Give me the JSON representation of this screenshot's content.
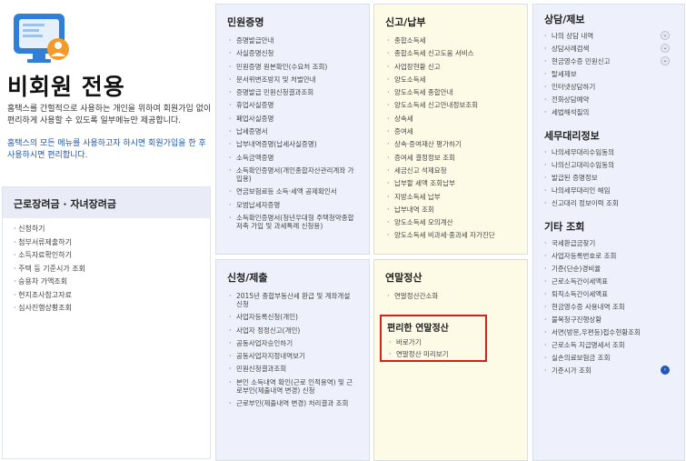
{
  "intro": {
    "title": "비회원 전용",
    "description": "홈택스를 간헐적으로 사용하는 개인을 위하여 회원가입 없이 편리하게 사용할 수 있도록 일부메뉴만 제공합니다.",
    "note": "홈택스의 모든 메뉴를 사용하고자 하시면 회원가입을 한 후 사용하시면 편리합니다."
  },
  "left_panel": {
    "title": "근로장려금 · 자녀장려금",
    "items": [
      "신청하기",
      "첨부서류제출하기",
      "소득자료확인하기",
      "주택 등 기준시가 조회",
      "승용차 가액조회",
      "현지조사참고자료",
      "심사진행상황조회"
    ]
  },
  "col_civil": {
    "title": "민원증명",
    "items": [
      "증명발급안내",
      "사실증명신청",
      "민원증명 원본확인(수요처 조회)",
      "문서위변조방지 및 처벌안내",
      "증명발급 민원신청결과조회",
      "휴업사실증명",
      "폐업사실증명",
      "납세증명서",
      "납부내역증명(납세사실증명)",
      "소득금액증명",
      "소득확인증명서(개인종합자산관리계좌 가입용)",
      "연금보험료등 소득·세액 공제확인서",
      "모범납세자증명",
      "소득확인증명서(청년우대형 주택청약종합저축 가입 및 과세특례 신청용)"
    ]
  },
  "col_report": {
    "title": "신고/납부",
    "items": [
      "종합소득세",
      "종합소득세 신고도움 서비스",
      "사업장현황 신고",
      "양도소득세",
      "양도소득세 종합안내",
      "양도소득세 신고안내정보조회",
      "상속세",
      "증여세",
      "상속·증여재산 평가하기",
      "증여세 결정정보 조회",
      "세금신고 석제요청",
      "납부할 세액 조회납부",
      "지방소득세 납부",
      "납부내역 조회",
      "양도소득세 모의계산",
      "양도소득세 비과세·중과세 자가진단"
    ]
  },
  "col_apply": {
    "title": "신청/제출",
    "items": [
      "2015년 종합부동산세 환급 및 계좌개설 신청",
      "사업자등록신청(개인)",
      "사업자 정정신고(개인)",
      "공동사업자승인하기",
      "공동사업자지정내역보기",
      "민원신청결과조회",
      "본인 소득내역 확인(근로 인적용역) 및 근로부인(제출내역 변경) 신청",
      "근로부인(제출내역 변경) 처리결과 조회"
    ]
  },
  "col_yearend": {
    "title": "연말정산",
    "items": [
      "연말정산간소화"
    ],
    "convenient": {
      "title": "편리한 연말정산",
      "items": [
        "바로가기",
        "연말정산 미리보기"
      ]
    }
  },
  "col_right": {
    "consult": {
      "title": "상담/제보",
      "items": [
        {
          "label": "나의 상담 내역",
          "toggle": "⌄"
        },
        {
          "label": "상담사례검색",
          "toggle": "⌄"
        },
        {
          "label": "현금영수증 민원신고",
          "toggle": "⌄"
        },
        {
          "label": "탈세제보",
          "toggle": ""
        },
        {
          "label": "인터넷상담하기",
          "toggle": ""
        },
        {
          "label": "전화상담예약",
          "toggle": ""
        },
        {
          "label": "세법해석질의",
          "toggle": ""
        }
      ]
    },
    "agent": {
      "title": "세무대리정보",
      "items": [
        "나의세무대리수임동의",
        "나의신고대리수임동의",
        "발급된 증명정보",
        "나의세무대리인 해임",
        "신고대리 정보이력 조회"
      ]
    },
    "other": {
      "title": "기타 조회",
      "items": [
        {
          "label": "국세환급금찾기",
          "toggle": ""
        },
        {
          "label": "사업자등록번호로 조회",
          "toggle": ""
        },
        {
          "label": "기준(단순)경비율",
          "toggle": ""
        },
        {
          "label": "근로소득간이세액표",
          "toggle": ""
        },
        {
          "label": "퇴직소득간이세액표",
          "toggle": ""
        },
        {
          "label": "현금영수증 사용내역 조회",
          "toggle": ""
        },
        {
          "label": "불복청구진행상황",
          "toggle": ""
        },
        {
          "label": "서면(방문,우편등)접수현황조회",
          "toggle": ""
        },
        {
          "label": "근로소득 지급명세서 조회",
          "toggle": ""
        },
        {
          "label": "실손의료보험금 조회",
          "toggle": ""
        },
        {
          "label": "기준시가 조회",
          "toggle": "›"
        }
      ]
    }
  }
}
